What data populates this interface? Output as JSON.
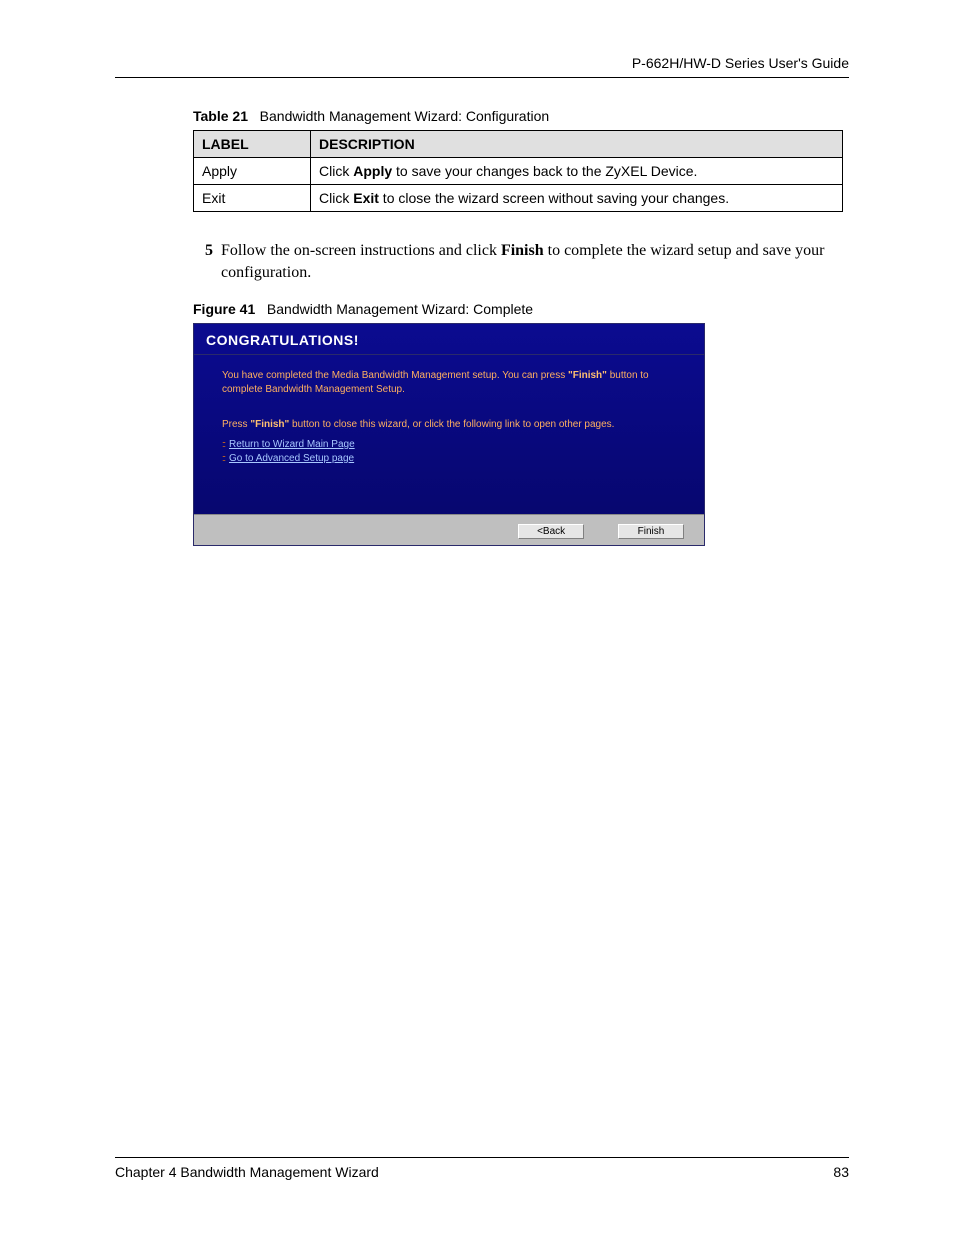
{
  "header": {
    "guide_title": "P-662H/HW-D Series User's Guide"
  },
  "table_caption": {
    "prefix": "Table 21",
    "title": "Bandwidth Management Wizard: Configuration"
  },
  "table": {
    "head_label": "LABEL",
    "head_desc": "DESCRIPTION",
    "rows": [
      {
        "label": "Apply",
        "desc_pre": "Click ",
        "desc_b": "Apply",
        "desc_post": " to save your changes back to the ZyXEL Device."
      },
      {
        "label": "Exit",
        "desc_pre": "Click ",
        "desc_b": "Exit",
        "desc_post": " to close the wizard screen without saving your changes."
      }
    ]
  },
  "step": {
    "num": "5",
    "text_pre": "Follow the on-screen instructions and click ",
    "text_b": "Finish",
    "text_post": " to complete the wizard setup and save your configuration."
  },
  "figure_caption": {
    "prefix": "Figure 41",
    "title": "Bandwidth Management Wizard: Complete"
  },
  "wizard": {
    "title": "CONGRATULATIONS!",
    "p1_pre": "You have completed the Media Bandwidth Management setup. You can press ",
    "p1_b": "\"Finish\"",
    "p1_post": " button to complete Bandwidth Management Setup.",
    "p2_pre": "Press ",
    "p2_b": "\"Finish\"",
    "p2_post": " button to close this wizard, or click the following link to open other pages.",
    "link1": "Return to Wizard Main Page",
    "link2": "Go to Advanced Setup page",
    "btn_back": "<Back",
    "btn_finish": "Finish"
  },
  "footer": {
    "chapter": "Chapter 4 Bandwidth Management Wizard",
    "page_num": "83"
  }
}
